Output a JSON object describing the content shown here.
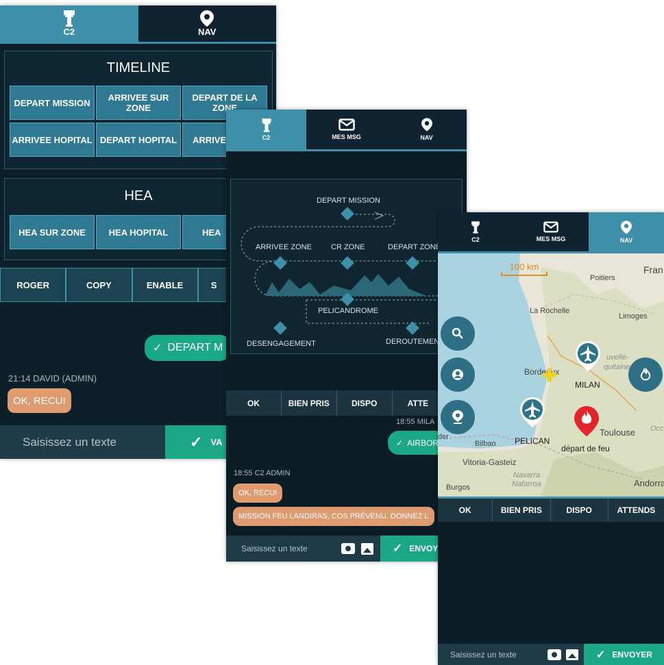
{
  "screen1": {
    "tabs": [
      {
        "label": "C2",
        "icon": "tower-icon",
        "active": true
      },
      {
        "label": "NAV",
        "icon": "map-pin-icon",
        "active": false
      }
    ],
    "timeline": {
      "title": "TIMELINE",
      "buttons": [
        "DEPART MISSION",
        "ARRIVEE SUR ZONE",
        "DEPART DE LA ZONE",
        "ARRIVEE HOPITAL",
        "DEPART HOPITAL",
        "ARRIVEE"
      ]
    },
    "hea": {
      "title": "HEA",
      "buttons": [
        "HEA SUR ZONE",
        "HEA HOPITAL",
        "HEA"
      ]
    },
    "quick_replies": [
      "ROGER",
      "COPY",
      "ENABLE",
      "S"
    ],
    "outgoing": "DEPART M",
    "incoming_meta": "21:14 DAVID (ADMIN)",
    "incoming": "OK, RECU!",
    "input_placeholder": "Saisissez un texte",
    "send_label": "VA"
  },
  "screen2": {
    "tabs": [
      {
        "label": "C2",
        "icon": "tower-icon",
        "active": true
      },
      {
        "label": "MES MSG",
        "icon": "mail-icon",
        "active": false
      },
      {
        "label": "NAV",
        "icon": "map-pin-icon",
        "active": false
      }
    ],
    "timeline_labels": {
      "depart_mission": "DEPART MISSION",
      "arrivee_zone": "ARRIVEE ZONE",
      "cr_zone": "CR ZONE",
      "depart_zone": "DEPART ZONE",
      "pelicandrome": "PELICANDROME",
      "desengagement": "DESENGAGEMENT",
      "deroutement": "DEROUTEMENT"
    },
    "quick_replies": [
      "OK",
      "BIEN PRIS",
      "DISPO",
      "ATTE"
    ],
    "outgoing_meta": "18:55 MILA",
    "outgoing": "AIRBOR",
    "incoming_meta": "18:55 C2 ADMIN",
    "incoming_1": "OK, RECU!",
    "incoming_2": "MISSION FEU LANDIRAS, COS PRÉVENU. DONNEZ L",
    "input_placeholder": "Saisissez un texte",
    "send_label": "ENVOY"
  },
  "screen3": {
    "tabs": [
      {
        "label": "C2",
        "icon": "tower-icon",
        "active": false
      },
      {
        "label": "MES MSG",
        "icon": "mail-icon",
        "active": false
      },
      {
        "label": "NAV",
        "icon": "map-pin-icon",
        "active": true
      }
    ],
    "map": {
      "scale": "100 km",
      "places": [
        "Poitiers",
        "Fran",
        "La Rochelle",
        "Limoges",
        "uvelle-",
        "quitaine",
        "Bordeaux",
        "Toulouse",
        "Occ",
        "Bilbao",
        "Vitoria-Gasteiz",
        "Navarra",
        "Nafarroa",
        "Burgos",
        "Andorra",
        "der"
      ],
      "markers": [
        {
          "label": "MILAN",
          "icon": "plane-marker-icon"
        },
        {
          "label": "PELICAN",
          "icon": "plane-marker-icon"
        },
        {
          "label": "départ de feu",
          "icon": "fire-marker-icon"
        }
      ]
    },
    "quick_replies": [
      "OK",
      "BIEN PRIS",
      "DISPO",
      "ATTENDS"
    ],
    "input_placeholder": "Saisissez un texte",
    "send_label": "ENVOYER"
  },
  "colors": {
    "accent": "#3e90a8",
    "send": "#1aa984",
    "incoming": "#de9b6f",
    "bg": "#0d1f28"
  }
}
